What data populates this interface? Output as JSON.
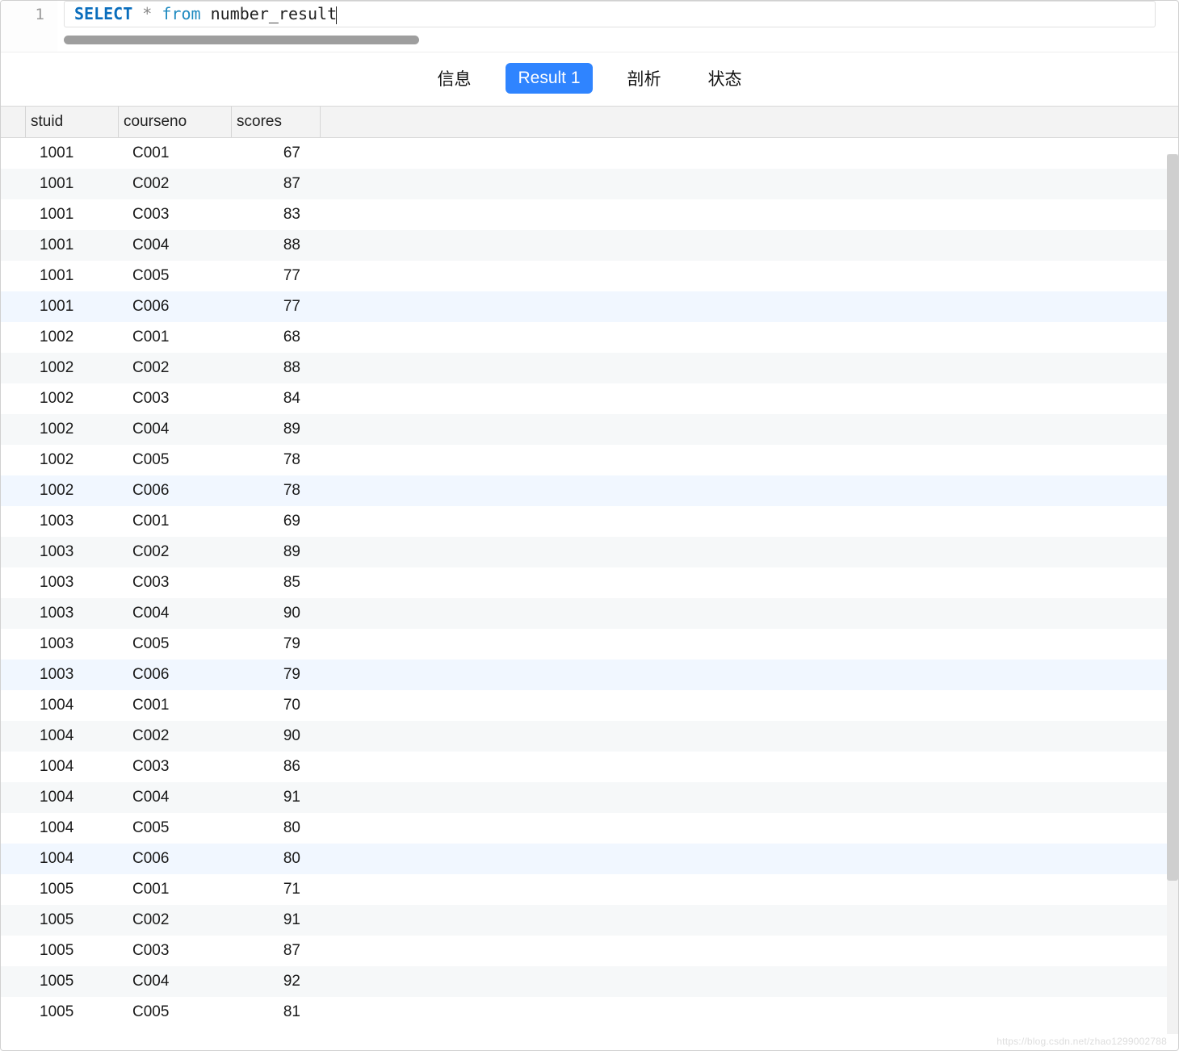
{
  "editor": {
    "line_number": "1",
    "tokens": {
      "select": "SELECT",
      "star": "*",
      "from": "from",
      "ident": "number_result"
    }
  },
  "tabs": [
    {
      "label": "信息",
      "active": false
    },
    {
      "label": "Result 1",
      "active": true
    },
    {
      "label": "剖析",
      "active": false
    },
    {
      "label": "状态",
      "active": false
    }
  ],
  "columns": [
    "stuid",
    "courseno",
    "scores"
  ],
  "rows": [
    {
      "stuid": "1001",
      "courseno": "C001",
      "scores": "67",
      "highlight": false
    },
    {
      "stuid": "1001",
      "courseno": "C002",
      "scores": "87",
      "highlight": false
    },
    {
      "stuid": "1001",
      "courseno": "C003",
      "scores": "83",
      "highlight": false
    },
    {
      "stuid": "1001",
      "courseno": "C004",
      "scores": "88",
      "highlight": false
    },
    {
      "stuid": "1001",
      "courseno": "C005",
      "scores": "77",
      "highlight": false
    },
    {
      "stuid": "1001",
      "courseno": "C006",
      "scores": "77",
      "highlight": true
    },
    {
      "stuid": "1002",
      "courseno": "C001",
      "scores": "68",
      "highlight": false
    },
    {
      "stuid": "1002",
      "courseno": "C002",
      "scores": "88",
      "highlight": false
    },
    {
      "stuid": "1002",
      "courseno": "C003",
      "scores": "84",
      "highlight": false
    },
    {
      "stuid": "1002",
      "courseno": "C004",
      "scores": "89",
      "highlight": false
    },
    {
      "stuid": "1002",
      "courseno": "C005",
      "scores": "78",
      "highlight": false
    },
    {
      "stuid": "1002",
      "courseno": "C006",
      "scores": "78",
      "highlight": true
    },
    {
      "stuid": "1003",
      "courseno": "C001",
      "scores": "69",
      "highlight": false
    },
    {
      "stuid": "1003",
      "courseno": "C002",
      "scores": "89",
      "highlight": false
    },
    {
      "stuid": "1003",
      "courseno": "C003",
      "scores": "85",
      "highlight": false
    },
    {
      "stuid": "1003",
      "courseno": "C004",
      "scores": "90",
      "highlight": false
    },
    {
      "stuid": "1003",
      "courseno": "C005",
      "scores": "79",
      "highlight": false
    },
    {
      "stuid": "1003",
      "courseno": "C006",
      "scores": "79",
      "highlight": true
    },
    {
      "stuid": "1004",
      "courseno": "C001",
      "scores": "70",
      "highlight": false
    },
    {
      "stuid": "1004",
      "courseno": "C002",
      "scores": "90",
      "highlight": false
    },
    {
      "stuid": "1004",
      "courseno": "C003",
      "scores": "86",
      "highlight": false
    },
    {
      "stuid": "1004",
      "courseno": "C004",
      "scores": "91",
      "highlight": false
    },
    {
      "stuid": "1004",
      "courseno": "C005",
      "scores": "80",
      "highlight": false
    },
    {
      "stuid": "1004",
      "courseno": "C006",
      "scores": "80",
      "highlight": true
    },
    {
      "stuid": "1005",
      "courseno": "C001",
      "scores": "71",
      "highlight": false
    },
    {
      "stuid": "1005",
      "courseno": "C002",
      "scores": "91",
      "highlight": false
    },
    {
      "stuid": "1005",
      "courseno": "C003",
      "scores": "87",
      "highlight": false
    },
    {
      "stuid": "1005",
      "courseno": "C004",
      "scores": "92",
      "highlight": false
    },
    {
      "stuid": "1005",
      "courseno": "C005",
      "scores": "81",
      "highlight": false
    }
  ],
  "watermark": "https://blog.csdn.net/zhao1299002788"
}
